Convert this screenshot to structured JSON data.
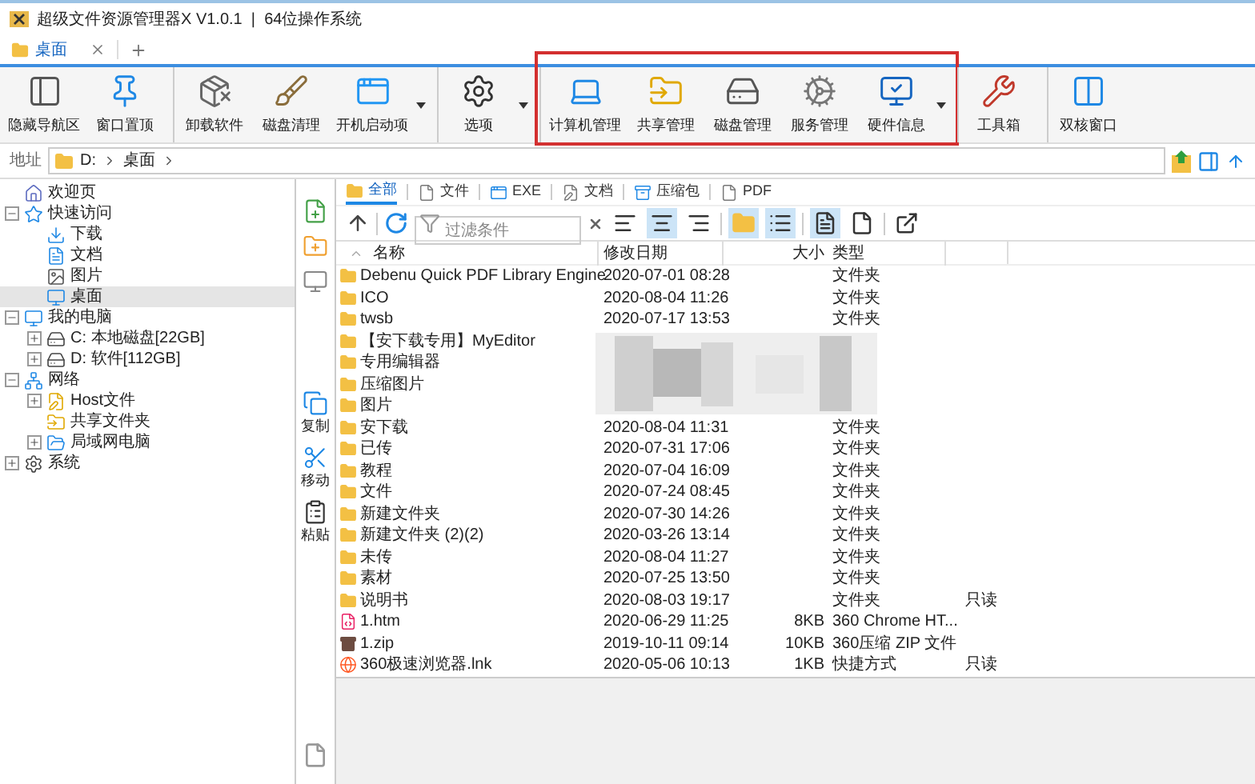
{
  "window": {
    "title": "超级文件资源管理器X V1.0.1  |  64位操作系统"
  },
  "tabs": [
    {
      "label": "桌面",
      "selected": true
    }
  ],
  "toolbar": [
    {
      "buttons": [
        {
          "kind": "panel",
          "label": "隐藏导航区"
        },
        {
          "kind": "pin",
          "label": "窗口置顶"
        }
      ]
    },
    {
      "dropdown": true,
      "buttons": [
        {
          "kind": "uninstall",
          "label": "卸载软件"
        },
        {
          "kind": "clean",
          "label": "磁盘清理"
        },
        {
          "kind": "startup",
          "label": "开机启动项"
        }
      ]
    },
    {
      "dropdown": true,
      "buttons": [
        {
          "kind": "gear",
          "label": "选项"
        }
      ]
    },
    {
      "dropdown": true,
      "highlighted": true,
      "buttons": [
        {
          "kind": "laptop",
          "label": "计算机管理"
        },
        {
          "kind": "share",
          "label": "共享管理"
        },
        {
          "kind": "disk",
          "label": "磁盘管理"
        },
        {
          "kind": "service",
          "label": "服务管理"
        },
        {
          "kind": "hardware",
          "label": "硬件信息"
        }
      ]
    },
    {
      "buttons": [
        {
          "kind": "tools",
          "label": "工具箱"
        }
      ]
    },
    {
      "buttons": [
        {
          "kind": "split",
          "label": "双核窗口"
        }
      ]
    }
  ],
  "address": {
    "label": "地址",
    "path": [
      "D:",
      "桌面"
    ]
  },
  "tree": [
    {
      "kind": "home",
      "label": "欢迎页"
    },
    {
      "kind": "star",
      "label": "快速访问",
      "expanded": true,
      "children": [
        {
          "kind": "download",
          "label": "下载"
        },
        {
          "kind": "doc",
          "label": "文档"
        },
        {
          "kind": "image",
          "label": "图片"
        },
        {
          "kind": "desktop",
          "label": "桌面",
          "selected": true
        }
      ]
    },
    {
      "kind": "computer",
      "label": "我的电脑",
      "expanded": true,
      "children": [
        {
          "kind": "drive",
          "label": "C: 本地磁盘[22GB]",
          "expanded": false
        },
        {
          "kind": "drive",
          "label": "D: 软件[112GB]",
          "expanded": false
        }
      ]
    },
    {
      "kind": "network",
      "label": "网络",
      "expanded": true,
      "children": [
        {
          "kind": "note",
          "label": "Host文件",
          "expanded": false
        },
        {
          "kind": "share",
          "label": "共享文件夹"
        },
        {
          "kind": "lan",
          "label": "局域网电脑",
          "expanded": false
        }
      ]
    },
    {
      "kind": "gear",
      "label": "系统",
      "expanded": false
    }
  ],
  "side_actions": [
    {
      "kind": "new-file"
    },
    {
      "kind": "new-folder"
    },
    {
      "kind": "screen"
    },
    {
      "kind": "copy",
      "label": "复制"
    },
    {
      "kind": "cut",
      "label": "移动"
    },
    {
      "kind": "paste",
      "label": "粘贴"
    }
  ],
  "filter_tabs": [
    {
      "kind": "folder",
      "label": "全部",
      "selected": true
    },
    {
      "kind": "file",
      "label": "文件",
      "selected": false
    },
    {
      "kind": "exe",
      "label": "EXE",
      "selected": false
    },
    {
      "kind": "doc",
      "label": "文档",
      "selected": false
    },
    {
      "kind": "zip",
      "label": "压缩包",
      "selected": false
    },
    {
      "kind": "file",
      "label": "PDF",
      "selected": false
    }
  ],
  "filter": {
    "placeholder": "过滤条件"
  },
  "view_buttons": [
    {
      "kind": "align-left",
      "selected": false
    },
    {
      "kind": "align-center",
      "selected": true
    },
    {
      "kind": "align-right",
      "selected": false
    },
    {
      "kind": "folder",
      "selected": true
    },
    {
      "kind": "details",
      "selected": true
    },
    {
      "kind": "preview",
      "selected": true
    },
    {
      "kind": "page",
      "selected": false
    },
    {
      "kind": "open",
      "selected": false
    }
  ],
  "table": {
    "columns": [
      "名称",
      "修改日期",
      "大小",
      "类型"
    ],
    "rows": [
      {
        "kind": "folder",
        "name": "Debenu Quick PDF Library Engine",
        "date": "2020-07-01 08:28",
        "type": "文件夹"
      },
      {
        "kind": "folder",
        "name": "ICO",
        "date": "2020-08-04 11:26",
        "type": "文件夹"
      },
      {
        "kind": "folder",
        "name": "twsb",
        "date": "2020-07-17 13:53",
        "type": "文件夹"
      },
      {
        "kind": "folder",
        "name": "【安下载专用】MyEditor"
      },
      {
        "kind": "folder",
        "name": "专用编辑器"
      },
      {
        "kind": "folder",
        "name": "压缩图片"
      },
      {
        "kind": "folder",
        "name": "图片"
      },
      {
        "kind": "folder",
        "name": "安下载",
        "date": "2020-08-04 11:31",
        "type": "文件夹"
      },
      {
        "kind": "folder",
        "name": "已传",
        "date": "2020-07-31 17:06",
        "type": "文件夹"
      },
      {
        "kind": "folder",
        "name": "教程",
        "date": "2020-07-04 16:09",
        "type": "文件夹"
      },
      {
        "kind": "folder",
        "name": "文件",
        "date": "2020-07-24 08:45",
        "type": "文件夹"
      },
      {
        "kind": "folder",
        "name": "新建文件夹",
        "date": "2020-07-30 14:26",
        "type": "文件夹"
      },
      {
        "kind": "folder",
        "name": "新建文件夹 (2)(2)",
        "date": "2020-03-26 13:14",
        "type": "文件夹"
      },
      {
        "kind": "folder",
        "name": "未传",
        "date": "2020-08-04 11:27",
        "type": "文件夹"
      },
      {
        "kind": "folder",
        "name": "素材",
        "date": "2020-07-25 13:50",
        "type": "文件夹"
      },
      {
        "kind": "folder",
        "name": "说明书",
        "date": "2020-08-03 19:17",
        "type": "文件夹",
        "attribute": "只读"
      },
      {
        "kind": "htm",
        "name": "1.htm",
        "date": "2020-06-29 11:25",
        "size": "8KB",
        "type": "360 Chrome HT..."
      },
      {
        "kind": "zip",
        "name": "1.zip",
        "date": "2019-10-11 09:14",
        "size": "10KB",
        "type": "360压缩 ZIP 文件"
      },
      {
        "kind": "lnk",
        "name": "360极速浏览器.lnk",
        "date": "2020-05-06 10:13",
        "size": "1KB",
        "type": "快捷方式",
        "attribute": "只读"
      }
    ]
  }
}
